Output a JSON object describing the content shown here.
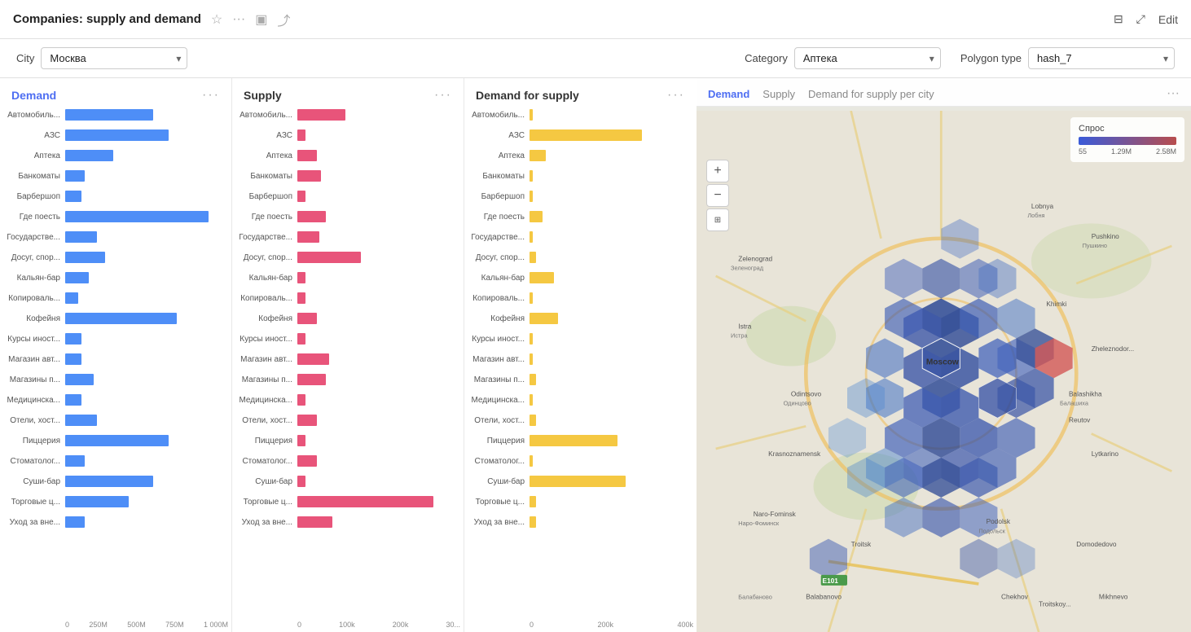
{
  "header": {
    "title": "Companies: supply and demand",
    "edit_label": "Edit",
    "icons": [
      "star",
      "more",
      "folder",
      "share",
      "panel",
      "expand"
    ]
  },
  "filters": {
    "city_label": "City",
    "city_value": "Москва",
    "category_label": "Category",
    "category_value": "Аптека",
    "polygon_label": "Polygon type",
    "polygon_value": "hash_7"
  },
  "demand_chart": {
    "title": "Demand",
    "more": "···",
    "categories": [
      {
        "label": "Автомобиль...",
        "value": 55
      },
      {
        "label": "АЗС",
        "value": 65
      },
      {
        "label": "Аптека",
        "value": 30
      },
      {
        "label": "Банкоматы",
        "value": 12
      },
      {
        "label": "Барбершоп",
        "value": 10
      },
      {
        "label": "Где поесть",
        "value": 90
      },
      {
        "label": "Государстве...",
        "value": 20
      },
      {
        "label": "Досуг, спор...",
        "value": 25
      },
      {
        "label": "Кальян-бар",
        "value": 15
      },
      {
        "label": "Копировaль...",
        "value": 8
      },
      {
        "label": "Кофейня",
        "value": 70
      },
      {
        "label": "Курсы иност...",
        "value": 10
      },
      {
        "label": "Магазин авт...",
        "value": 10
      },
      {
        "label": "Магазины п...",
        "value": 18
      },
      {
        "label": "Медицинска...",
        "value": 10
      },
      {
        "label": "Отели, хост...",
        "value": 20
      },
      {
        "label": "Пиццерия",
        "value": 65
      },
      {
        "label": "Стоматолог...",
        "value": 12
      },
      {
        "label": "Суши-бар",
        "value": 55
      },
      {
        "label": "Торговые ц...",
        "value": 40
      },
      {
        "label": "Уход за вне...",
        "value": 12
      }
    ],
    "axis": [
      "0",
      "250M",
      "500M",
      "750M",
      "1 000M"
    ]
  },
  "supply_chart": {
    "title": "Supply",
    "more": "···",
    "categories": [
      {
        "label": "Автомобиль...",
        "value": 30
      },
      {
        "label": "АЗС",
        "value": 5
      },
      {
        "label": "Аптека",
        "value": 12
      },
      {
        "label": "Банкоматы",
        "value": 15
      },
      {
        "label": "Барбершоп",
        "value": 5
      },
      {
        "label": "Где поесть",
        "value": 18
      },
      {
        "label": "Государстве...",
        "value": 14
      },
      {
        "label": "Досуг, спор...",
        "value": 40
      },
      {
        "label": "Кальян-бар",
        "value": 5
      },
      {
        "label": "Копировaль...",
        "value": 5
      },
      {
        "label": "Кофейня",
        "value": 12
      },
      {
        "label": "Курсы иност...",
        "value": 5
      },
      {
        "label": "Магазин авт...",
        "value": 20
      },
      {
        "label": "Магазины п...",
        "value": 18
      },
      {
        "label": "Медицинска...",
        "value": 5
      },
      {
        "label": "Отели, хост...",
        "value": 12
      },
      {
        "label": "Пиццерия",
        "value": 5
      },
      {
        "label": "Стоматолог...",
        "value": 12
      },
      {
        "label": "Суши-бар",
        "value": 5
      },
      {
        "label": "Торговые ц...",
        "value": 85
      },
      {
        "label": "Уход за вне...",
        "value": 22
      }
    ],
    "axis": [
      "0",
      "100k",
      "200k",
      "30..."
    ]
  },
  "demand_supply_chart": {
    "title": "Demand for supply",
    "more": "···",
    "categories": [
      {
        "label": "Автомобиль...",
        "value": 2
      },
      {
        "label": "АЗС",
        "value": 70
      },
      {
        "label": "Аптека",
        "value": 10
      },
      {
        "label": "Банкоматы",
        "value": 2
      },
      {
        "label": "Барбершоп",
        "value": 2
      },
      {
        "label": "Где поесть",
        "value": 8
      },
      {
        "label": "Государстве...",
        "value": 2
      },
      {
        "label": "Досуг, спор...",
        "value": 4
      },
      {
        "label": "Кальян-бар",
        "value": 15
      },
      {
        "label": "Копировaль...",
        "value": 2
      },
      {
        "label": "Кофейня",
        "value": 18
      },
      {
        "label": "Курсы иност...",
        "value": 2
      },
      {
        "label": "Магазин авт...",
        "value": 2
      },
      {
        "label": "Магазины п...",
        "value": 4
      },
      {
        "label": "Медицинска...",
        "value": 2
      },
      {
        "label": "Отели, хост...",
        "value": 4
      },
      {
        "label": "Пиццерия",
        "value": 55
      },
      {
        "label": "Стоматолог...",
        "value": 2
      },
      {
        "label": "Суши-бар",
        "value": 60
      },
      {
        "label": "Торговые ц...",
        "value": 4
      },
      {
        "label": "Уход за вне...",
        "value": 4
      }
    ],
    "axis": [
      "0",
      "200k",
      "400k"
    ]
  },
  "map": {
    "tabs": [
      "Demand",
      "Supply",
      "Demand for supply per city"
    ],
    "active_tab": "Demand",
    "more": "···",
    "legend": {
      "title": "Спрос",
      "min": "55",
      "mid": "1.29M",
      "max": "2.58M"
    },
    "zoom_in": "+",
    "zoom_out": "−"
  }
}
